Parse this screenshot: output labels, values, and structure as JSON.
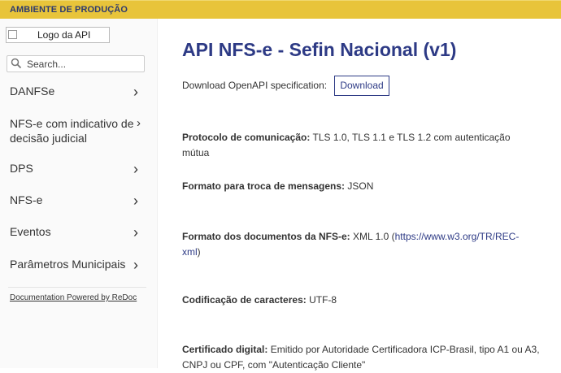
{
  "env_banner": "AMBIENTE DE PRODUÇÃO",
  "sidebar": {
    "logo_alt": "Logo da API",
    "search_placeholder": "Search...",
    "items": [
      {
        "label": "DANFSe"
      },
      {
        "label_line1": "NFS-e com indicativo de",
        "label_line2": "decisão judicial"
      },
      {
        "label": "DPS"
      },
      {
        "label": "NFS-e"
      },
      {
        "label": "Eventos"
      },
      {
        "label": "Parâmetros Municipais"
      }
    ],
    "powered_by": "Documentation Powered by ReDoc"
  },
  "main": {
    "title": "API NFS-e - Sefin Nacional (v1)",
    "download_label": "Download OpenAPI specification:",
    "download_button": "Download",
    "protocol_label": "Protocolo de comunicação:",
    "protocol_value": "TLS 1.0, TLS 1.1 e TLS 1.2 com autenticação mútua",
    "format_label": "Formato para troca de mensagens:",
    "format_value": "JSON",
    "docformat_label": "Formato dos documentos da NFS-e:",
    "docformat_value_pre": "XML 1.0 (",
    "docformat_link": "https://www.w3.org/TR/REC-xml",
    "docformat_value_post": ")",
    "encoding_label": "Codificação de caracteres:",
    "encoding_value": "UTF-8",
    "cert_label": "Certificado digital:",
    "cert_value": "Emitido por Autoridade Certificadora ICP-Brasil, tipo A1 ou A3, CNPJ ou CPF, com \"Autenticação Cliente\""
  },
  "colors": {
    "banner": "#e8c43a",
    "accent": "#2d3a85"
  },
  "icons": {
    "search": "search-icon",
    "chevron": "chevron-right-icon",
    "logo": "broken-image-icon"
  }
}
